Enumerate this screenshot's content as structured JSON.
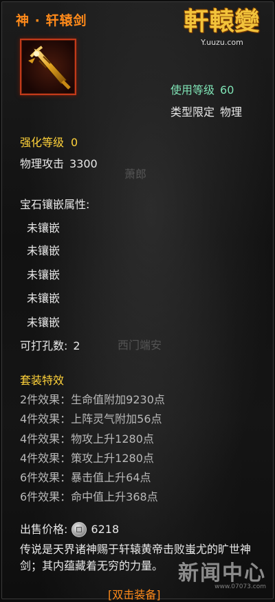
{
  "item": {
    "name": "神 · 轩辕剑",
    "icon": "golden-sword-icon"
  },
  "logo": {
    "title": "軒轅變",
    "url": "Y.uuzu.com"
  },
  "requirements": {
    "level_label": "使用等级",
    "level_value": "60",
    "type_label": "类型限定",
    "type_value": "物理"
  },
  "stats": {
    "enhance_label": "强化等级",
    "enhance_value": "0",
    "attack_label": "物理攻击",
    "attack_value": "3300"
  },
  "gems": {
    "header": "宝石镶嵌属性:",
    "sockets": [
      "未镶嵌",
      "未镶嵌",
      "未镶嵌",
      "未镶嵌",
      "未镶嵌"
    ],
    "punch_label": "可打孔数:",
    "punch_value": "2"
  },
  "set": {
    "header": "套装特效",
    "effects": [
      "2件效果：生命值附加9230点",
      "4件效果：上阵灵气附加56点",
      "4件效果：物攻上升1280点",
      "4件效果：策攻上升1280点",
      "6件效果：暴击值上升64点",
      "6件效果：命中值上升368点"
    ]
  },
  "price": {
    "label": "出售价格:",
    "value": "6218"
  },
  "description": "传说是天界诸神赐于轩辕黄帝击败蚩尤的旷世神剑；其内蕴藏着无穷的力量。",
  "action": "[双击装备]",
  "background_labels": {
    "npc1": "萧郎",
    "npc2": "西门端安"
  },
  "watermark": {
    "big": "新闻中心",
    "small": "www.07073.com"
  },
  "colors": {
    "title": "#ff8a1a",
    "green": "#7fe3b5",
    "yellow": "#ffd23a",
    "border_red": "#c23a1a"
  }
}
